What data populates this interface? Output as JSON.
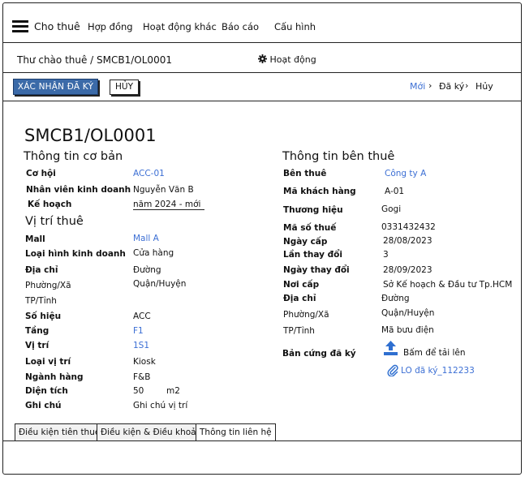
{
  "nav": {
    "items": [
      "Cho thuê",
      "Hợp đồng",
      "Hoạt động khác",
      "Báo cáo",
      "Cấu hình"
    ],
    "menu_icon": "hamburger-menu-icon"
  },
  "breadcrumb": {
    "text": "Thư chào thuê / SMCB1/OL0001",
    "activity_label": "Hoạt động",
    "activity_icon": "gear-icon"
  },
  "toolbar": {
    "confirm_label": "XÁC NHẬN ĐÃ KÝ",
    "cancel_label": "HỦY",
    "statuses": [
      "Mới",
      "Đã ký",
      "Hủy"
    ],
    "active_status": "Mới",
    "separator": "›"
  },
  "record": {
    "title": "SMCB1/OL0001",
    "basic": {
      "heading": "Thông tin cơ bản",
      "opportunity_label": "Cơ hội",
      "opportunity_value": "ACC-01",
      "salesperson_label": "Nhân viên kinh doanh",
      "salesperson_value": "Nguyễn Văn B",
      "plan_label": "Kế hoạch",
      "plan_value": "năm 2024 - mới"
    },
    "location": {
      "heading": "Vị trí thuê",
      "mall_label": "Mall",
      "mall_value": "Mall A",
      "business_type_label": "Loại hình kinh doanh",
      "business_type_value": "Cửa hàng",
      "address_label": "Địa chỉ",
      "address_value": "Đường",
      "ward_label": "Phường/Xã",
      "district_value": "Quận/Huyện",
      "city_label": "TP/Tỉnh",
      "number_label": "Số hiệu",
      "number_value": "ACC",
      "floor_label": "Tầng",
      "floor_value": "F1",
      "position_label": "Vị trí",
      "position_value": "1S1",
      "position_type_label": "Loại vị trí",
      "position_type_value": "Kiosk",
      "industry_label": "Ngành hàng",
      "industry_value": "F&B",
      "area_label": "Diện tích",
      "area_value": "50",
      "area_unit": "m2",
      "note_label": "Ghi chú",
      "note_value": "Ghi chú vị trí"
    },
    "tenant": {
      "heading": "Thông tin bên thuê",
      "tenant_label": "Bên thuê",
      "tenant_value": "Công ty A",
      "customer_code_label": "Mã khách hàng",
      "customer_code_value": "A-01",
      "brand_label": "Thương hiệu",
      "brand_value": "Gogi",
      "tax_label": "Mã số thuế",
      "tax_value": "0331432432",
      "issue_date_label": "Ngày cấp",
      "issue_date_value": "28/08/2023",
      "changes_label": "Lần thay đổi",
      "changes_value": "3",
      "change_date_label": "Ngày thay đổi",
      "change_date_value": "28/09/2023",
      "issuer_label": "Nơi cấp",
      "issuer_value": "Sở Kế hoạch & Đầu tư Tp.HCM",
      "address_label": "Địa chỉ",
      "address_value": "Đường",
      "ward_label": "Phường/Xã",
      "district_value": "Quận/Huyện",
      "city_label": "TP/Tỉnh",
      "postal_value": "Mã bưu điện",
      "signed_label": "Bản cứng đã ký",
      "upload_label": "Bấm để tải lên",
      "upload_icon": "upload-icon",
      "attachment_label": "LO đã ký_112233",
      "attachment_icon": "paperclip-icon"
    }
  },
  "tabs": [
    "Điều kiện tiên thuê",
    "Điều kiện & Điều khoản",
    "Thông tin liên hệ"
  ],
  "colors": {
    "accent": "#3c6fd4",
    "confirm_button": "#3b6aa8",
    "border": "#222222"
  }
}
